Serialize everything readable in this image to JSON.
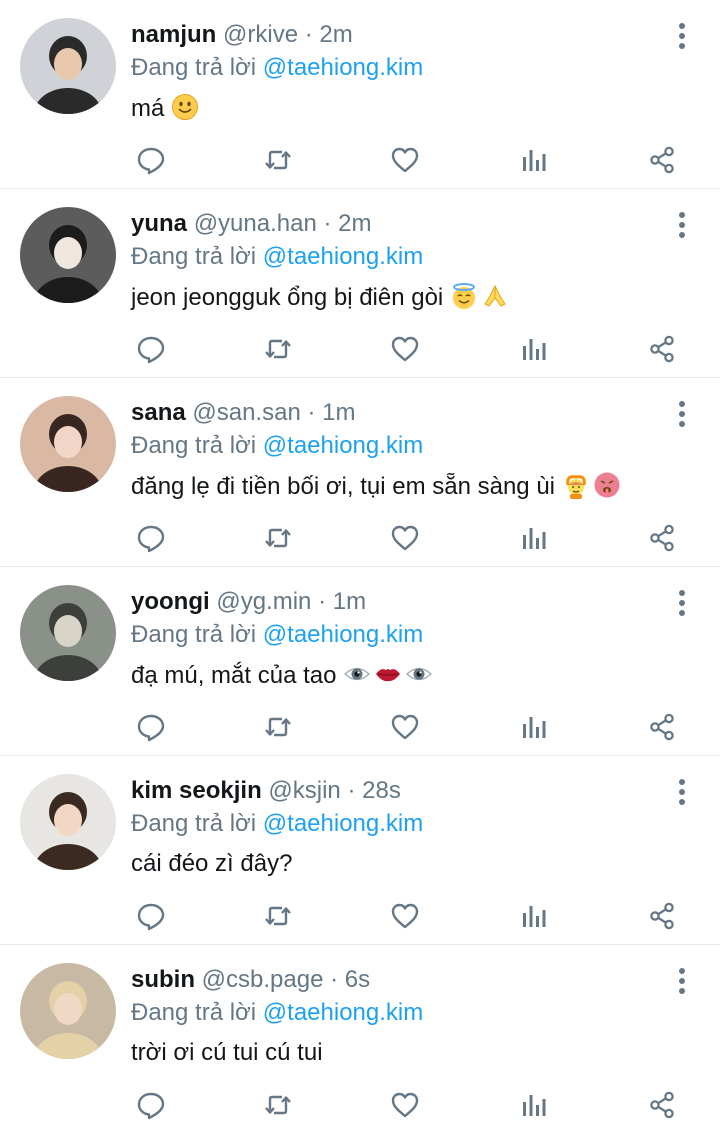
{
  "reply_prefix": "Đang trả lời",
  "tweets": [
    {
      "name": "namjun",
      "handle": "@rkive",
      "separator": "·",
      "time": "2m",
      "reply_to": "@taehiong.kim",
      "text": "má",
      "emojis": [
        "slightly-smiling-face"
      ],
      "avatar_colors": [
        "#cfd2d6",
        "#2a2a2a",
        "#e9c9ad"
      ]
    },
    {
      "name": "yuna",
      "handle": "@yuna.han",
      "separator": "·",
      "time": "2m",
      "reply_to": "@taehiong.kim",
      "text": "jeon jeongguk ổng bị điên gòi",
      "emojis": [
        "smiling-face-with-halo",
        "folded-hands"
      ],
      "avatar_colors": [
        "#5c5c5c",
        "#1c1c1c",
        "#efe6de"
      ]
    },
    {
      "name": "sana",
      "handle": "@san.san",
      "separator": "·",
      "time": "1m",
      "reply_to": "@taehiong.kim",
      "text": "đăng lẹ đi tiền bối ơi, tụi em sẵn sàng ùi",
      "emojis": [
        "person-gesturing-ok",
        "hot-face"
      ],
      "avatar_colors": [
        "#d9b8a4",
        "#3a2620",
        "#f1d6c8"
      ]
    },
    {
      "name": "yoongi",
      "handle": "@yg.min",
      "separator": "·",
      "time": "1m",
      "reply_to": "@taehiong.kim",
      "text": "đạ mú, mắt của tao",
      "emojis": [
        "eye",
        "mouth",
        "eye"
      ],
      "avatar_colors": [
        "#8a9188",
        "#3d3f3c",
        "#d8d4c8"
      ]
    },
    {
      "name": "kim seokjin",
      "handle": "@ksjin",
      "separator": "·",
      "time": "28s",
      "reply_to": "@taehiong.kim",
      "text": "cái đéo zì đây?",
      "emojis": [],
      "avatar_colors": [
        "#e8e6e2",
        "#3a2a22",
        "#f2d8c4"
      ]
    },
    {
      "name": "subin",
      "handle": "@csb.page",
      "separator": "·",
      "time": "6s",
      "reply_to": "@taehiong.kim",
      "text": "trời ơi cú tui cú tui",
      "emojis": [],
      "avatar_colors": [
        "#c7b9a4",
        "#e4d1a8",
        "#f0d9c4"
      ]
    }
  ],
  "colors": {
    "link": "#1da1f2",
    "muted": "#657786",
    "text": "#14171a",
    "divider": "#e6ecf0"
  },
  "icons": [
    "reply-icon",
    "retweet-icon",
    "like-icon",
    "stats-icon",
    "share-icon",
    "more-icon"
  ]
}
